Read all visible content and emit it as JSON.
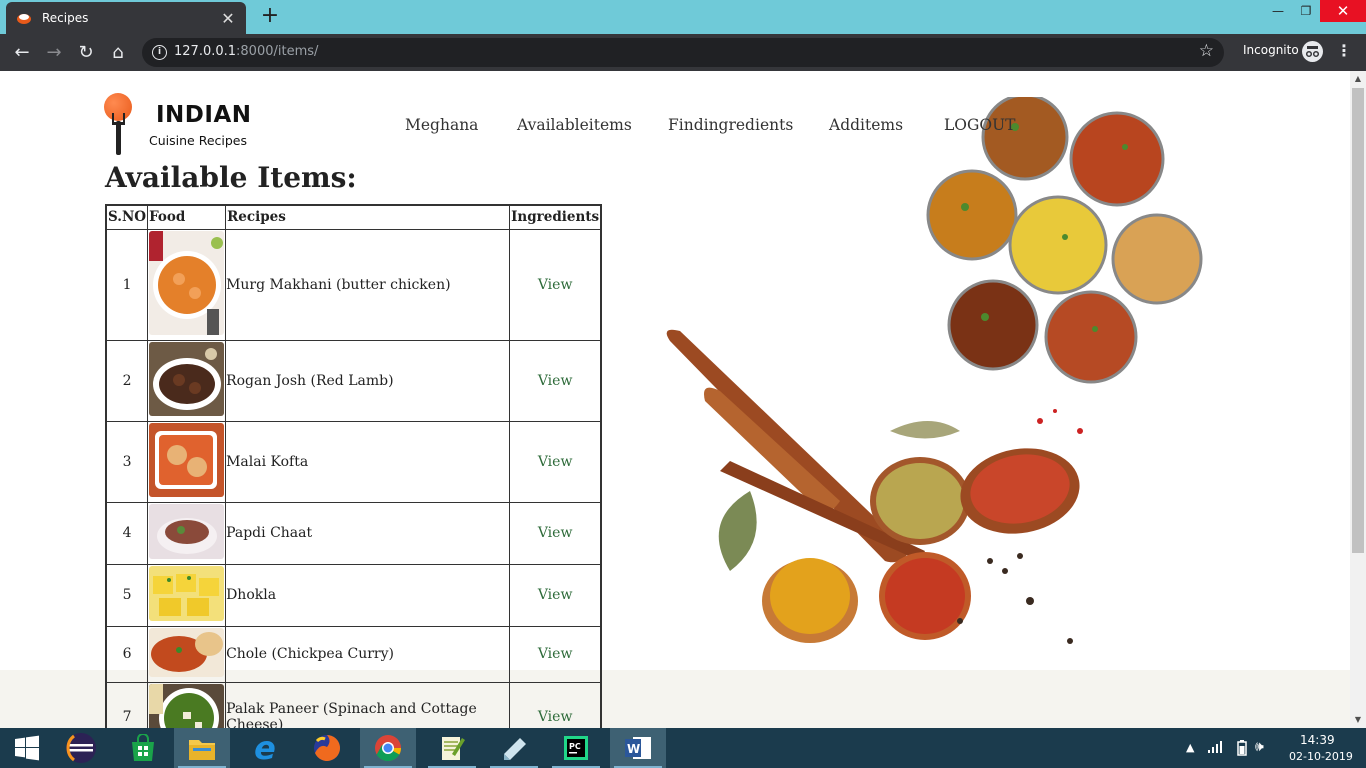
{
  "browser": {
    "tab_title": "Recipes",
    "tab_close": "✕",
    "new_tab": "+",
    "url_host": "127.0.0.1",
    "url_path": ":8000/items/",
    "profile_label": "Incognito",
    "window_controls": {
      "minimize": "—",
      "restore": "❐",
      "close": "✕"
    }
  },
  "logo": {
    "title": "INDIAN",
    "subtitle": "Cuisine Recipes",
    "accent": "#e85a1a"
  },
  "nav": {
    "items": [
      "Meghana",
      "Availableitems",
      "Findingredients",
      "Additems",
      "LOGOUT"
    ]
  },
  "page": {
    "heading": "Available Items:"
  },
  "table": {
    "headers": [
      "S.NO",
      "Food",
      "Recipes",
      "Ingredients"
    ],
    "rows": [
      {
        "sno": "1",
        "recipe": "Murg Makhani (butter chicken)",
        "link": "View"
      },
      {
        "sno": "2",
        "recipe": "Rogan Josh (Red Lamb)",
        "link": "View"
      },
      {
        "sno": "3",
        "recipe": "Malai Kofta",
        "link": "View"
      },
      {
        "sno": "4",
        "recipe": "Papdi Chaat",
        "link": "View"
      },
      {
        "sno": "5",
        "recipe": "Dhokla",
        "link": "View"
      },
      {
        "sno": "6",
        "recipe": "Chole (Chickpea Curry)",
        "link": "View"
      },
      {
        "sno": "7",
        "recipe": "Palak Paneer (Spinach and Cottage Cheese)",
        "link": "View"
      }
    ]
  },
  "taskbar": {
    "apps": [
      "start-icon",
      "eclipse-icon",
      "store-icon",
      "file-explorer-icon",
      "internet-explorer-icon",
      "firefox-icon",
      "chrome-icon",
      "notepad-plus-icon",
      "notes-icon",
      "pycharm-icon",
      "word-icon"
    ],
    "time": "14:39",
    "date": "02-10-2019"
  }
}
